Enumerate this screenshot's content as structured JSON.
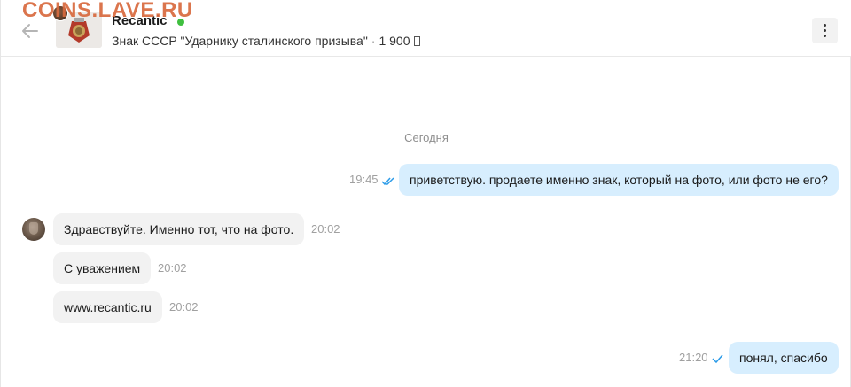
{
  "watermark": "COINS.LAVE.RU",
  "header": {
    "seller_name": "Recantic",
    "online": true,
    "item_title": "Знак СССР \"Ударнику сталинского призыва\"",
    "separator": "·",
    "price": "1 900",
    "back_icon": "arrow-left-icon",
    "menu_icon": "kebab-menu-icon"
  },
  "chat": {
    "date_label": "Сегодня",
    "messages": [
      {
        "direction": "out",
        "text": "приветствую. продаете именно знак, который на фото, или фото не его?",
        "time": "19:45",
        "status": "read"
      },
      {
        "direction": "in",
        "text": "Здравствуйте. Именно тот, что на фото.",
        "time": "20:02"
      },
      {
        "direction": "in",
        "text": "С уважением",
        "time": "20:02"
      },
      {
        "direction": "in",
        "text": "www.recantic.ru",
        "time": "20:02"
      },
      {
        "direction": "out",
        "text": "понял, спасибо",
        "time": "21:20",
        "status": "sent"
      }
    ]
  },
  "colors": {
    "outgoing_bubble": "#d7eefe",
    "incoming_bubble": "#f2f2f2",
    "online": "#3fbf3f",
    "check": "#2b9be8",
    "watermark": "#d86a3e"
  }
}
